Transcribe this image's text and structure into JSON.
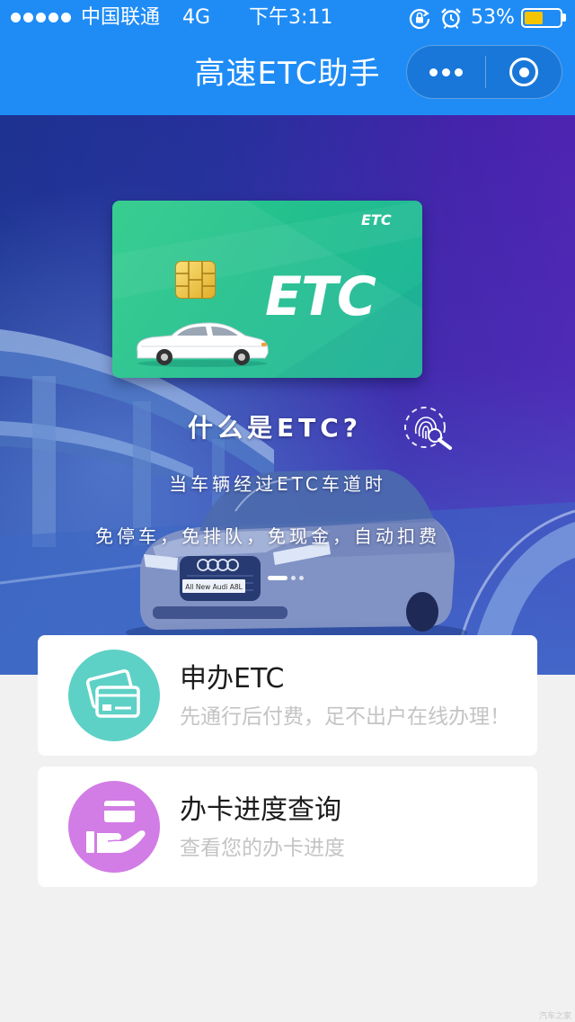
{
  "status_bar": {
    "signal_strength": 5,
    "carrier": "中国联通",
    "network": "4G",
    "time": "下午3:11",
    "battery_label": "53%",
    "battery_level": 0.53,
    "icons": [
      "signal-strength-icon",
      "rotation-lock-icon",
      "alarm-icon",
      "battery-icon"
    ]
  },
  "nav": {
    "title": "高速ETC助手",
    "icons": [
      "more-icon",
      "exit-target-icon"
    ]
  },
  "banner": {
    "card_brand_small": "ETC",
    "card_brand_large": "ETC",
    "heading": "什么是ETC?",
    "line1": "当车辆经过ETC车道时",
    "line2": "免停车，免排队，免现金，自动扣费",
    "plate_text": "All New Audi A8L",
    "slides": 3,
    "active_slide": 0
  },
  "services": [
    {
      "title": "申办ETC",
      "subtitle": "先通行后付费，足不出户在线办理！",
      "icon": "credit-cards-icon",
      "icon_color": "#5ed1c6"
    },
    {
      "title": "办卡进度查询",
      "subtitle": "查看您的办卡进度",
      "icon": "hand-card-icon",
      "icon_color": "#d27ce5"
    }
  ],
  "watermark": "汽车之家",
  "theme": {
    "primary": "#1f8cf6",
    "page_bg": "#f1f1f1",
    "battery_fill": "#f5c400"
  }
}
